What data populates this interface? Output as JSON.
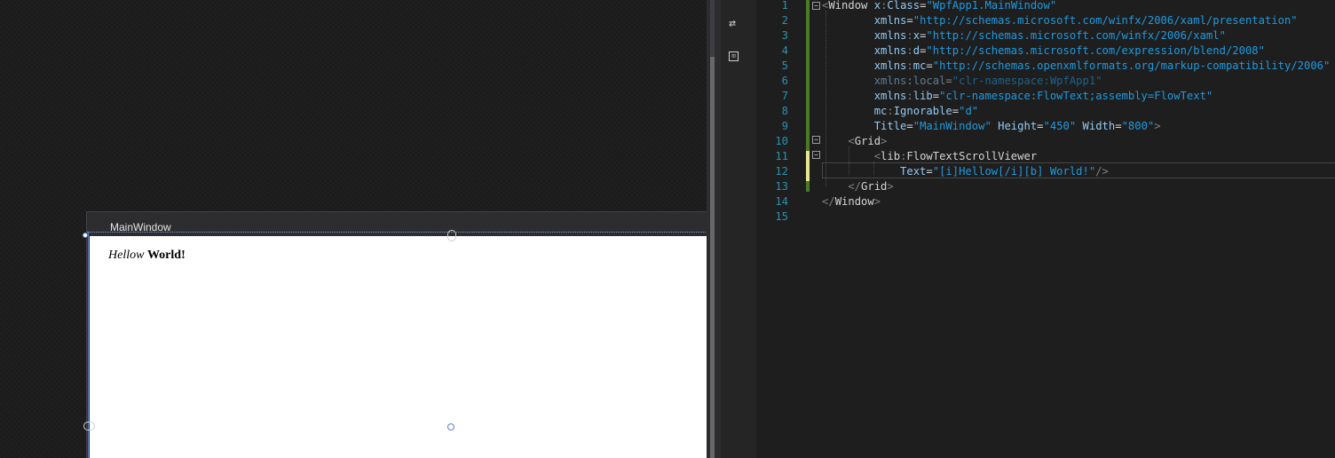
{
  "designer": {
    "window_title": "MainWindow",
    "content": {
      "italic_text": "Hellow",
      "bold_text": "World!"
    }
  },
  "toolbar": {
    "swap_icon_glyph": "⇄",
    "pane_icon_glyph": "⊡"
  },
  "editor": {
    "lines": [
      {
        "n": "1",
        "tokens": [
          [
            "punc",
            "<"
          ],
          [
            "tag",
            "Window "
          ],
          [
            "pre",
            "x"
          ],
          [
            "punc",
            ":"
          ],
          [
            "attr",
            "Class"
          ],
          [
            "eq",
            "="
          ],
          [
            "val",
            "\"WpfApp1.MainWindow\""
          ]
        ]
      },
      {
        "n": "2",
        "tokens": [
          [
            "attr",
            "        xmlns"
          ],
          [
            "eq",
            "="
          ],
          [
            "val",
            "\"http://schemas.microsoft.com/winfx/2006/xaml/presentation\""
          ]
        ]
      },
      {
        "n": "3",
        "tokens": [
          [
            "pre",
            "        xmlns"
          ],
          [
            "punc",
            ":"
          ],
          [
            "attr",
            "x"
          ],
          [
            "eq",
            "="
          ],
          [
            "val",
            "\"http://schemas.microsoft.com/winfx/2006/xaml\""
          ]
        ]
      },
      {
        "n": "4",
        "tokens": [
          [
            "pre",
            "        xmlns"
          ],
          [
            "punc",
            ":"
          ],
          [
            "attr",
            "d"
          ],
          [
            "eq",
            "="
          ],
          [
            "val",
            "\"http://schemas.microsoft.com/expression/blend/2008\""
          ]
        ]
      },
      {
        "n": "5",
        "tokens": [
          [
            "pre",
            "        xmlns"
          ],
          [
            "punc",
            ":"
          ],
          [
            "attr",
            "mc"
          ],
          [
            "eq",
            "="
          ],
          [
            "val",
            "\"http://schemas.openxmlformats.org/markup-compatibility/2006\""
          ]
        ]
      },
      {
        "n": "6",
        "dim": true,
        "tokens": [
          [
            "pre",
            "        xmlns"
          ],
          [
            "punc",
            ":"
          ],
          [
            "attr",
            "local"
          ],
          [
            "eq",
            "="
          ],
          [
            "val",
            "\"clr-namespace:WpfApp1\""
          ]
        ]
      },
      {
        "n": "7",
        "tokens": [
          [
            "pre",
            "        xmlns"
          ],
          [
            "punc",
            ":"
          ],
          [
            "attr",
            "lib"
          ],
          [
            "eq",
            "="
          ],
          [
            "val",
            "\"clr-namespace:FlowText;assembly=FlowText\""
          ]
        ]
      },
      {
        "n": "8",
        "tokens": [
          [
            "pre",
            "        mc"
          ],
          [
            "punc",
            ":"
          ],
          [
            "attr",
            "Ignorable"
          ],
          [
            "eq",
            "="
          ],
          [
            "val",
            "\"d\""
          ]
        ]
      },
      {
        "n": "9",
        "tokens": [
          [
            "attr",
            "        Title"
          ],
          [
            "eq",
            "="
          ],
          [
            "val",
            "\"MainWindow\""
          ],
          [
            "attr",
            " Height"
          ],
          [
            "eq",
            "="
          ],
          [
            "val",
            "\"450\""
          ],
          [
            "attr",
            " Width"
          ],
          [
            "eq",
            "="
          ],
          [
            "val",
            "\"800\""
          ],
          [
            "punc",
            ">"
          ]
        ]
      },
      {
        "n": "10",
        "tokens": [
          [
            "punc",
            "    <"
          ],
          [
            "tag",
            "Grid"
          ],
          [
            "punc",
            ">"
          ]
        ]
      },
      {
        "n": "11",
        "tokens": [
          [
            "punc",
            "        <"
          ],
          [
            "tag",
            "lib"
          ],
          [
            "punc",
            ":"
          ],
          [
            "tag",
            "FlowTextScrollViewer"
          ]
        ]
      },
      {
        "n": "12",
        "tokens": [
          [
            "attr",
            "            Text"
          ],
          [
            "eq",
            "="
          ],
          [
            "val",
            "\"[i]Hellow[/i][b] World!\""
          ],
          [
            "punc",
            "/>"
          ]
        ]
      },
      {
        "n": "13",
        "tokens": [
          [
            "punc",
            "    </"
          ],
          [
            "tag",
            "Grid"
          ],
          [
            "punc",
            ">"
          ]
        ]
      },
      {
        "n": "14",
        "tokens": [
          [
            "punc",
            "</"
          ],
          [
            "tag",
            "Window"
          ],
          [
            "punc",
            ">"
          ]
        ]
      },
      {
        "n": "15",
        "tokens": []
      }
    ]
  }
}
